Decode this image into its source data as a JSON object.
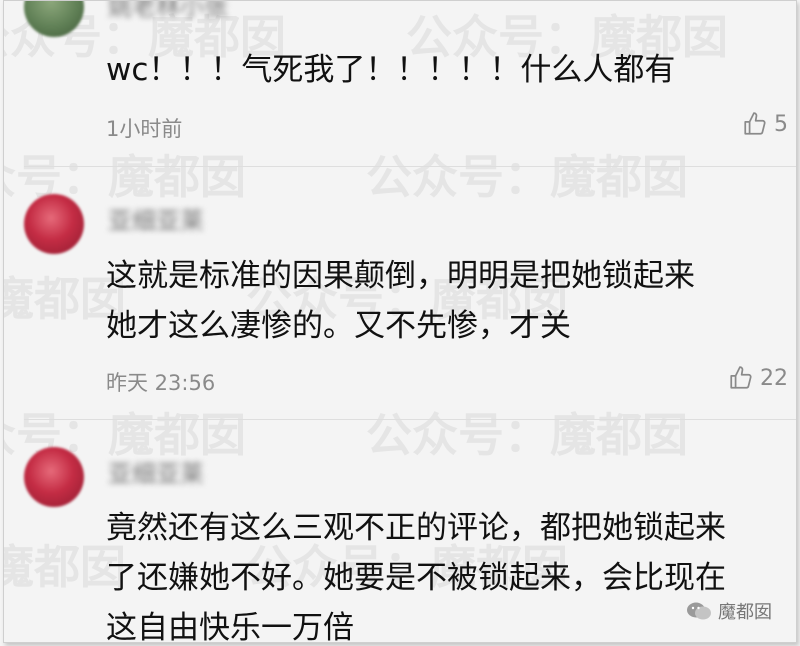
{
  "watermark": {
    "text": "公众号：魔都囡"
  },
  "comments": [
    {
      "username": "姚老林小张",
      "text_lines": [
        "wc！！！气死我了！！！！！什么人都有"
      ],
      "time": "1小时前",
      "likes": "5",
      "avatar_color": "#6f8f62"
    },
    {
      "username": "亚细亚莱",
      "text_lines": [
        "这就是标准的因果颠倒，明明是把她锁起来",
        "她才这么凄惨的。又不先惨，才关"
      ],
      "time": "昨天 23:56",
      "likes": "22",
      "avatar_color": "#c42c44"
    },
    {
      "username": "亚细亚莱",
      "text_lines": [
        "竟然还有这么三观不正的评论，都把她锁起来",
        "了还嫌她不好。她要是不被锁起来，会比现在",
        "这自由快乐一万倍"
      ]
    }
  ],
  "badge": {
    "text": "魔都囡"
  }
}
